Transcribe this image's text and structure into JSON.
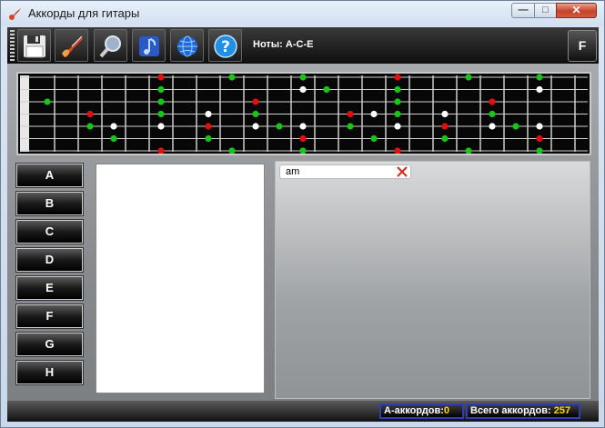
{
  "window": {
    "title": "Аккорды для гитары",
    "buttons": {
      "minimize": "—",
      "maximize": "□",
      "close": "✕"
    }
  },
  "toolbar": {
    "buttons": [
      {
        "name": "save-button",
        "icon": "floppy-disk-icon"
      },
      {
        "name": "guitar-button",
        "icon": "guitar-icon"
      },
      {
        "name": "search-button",
        "icon": "magnifier-icon"
      },
      {
        "name": "music-button",
        "icon": "music-note-icon"
      },
      {
        "name": "web-button",
        "icon": "globe-icon"
      },
      {
        "name": "help-button",
        "icon": "help-icon"
      }
    ],
    "notes_label": "Ноты: A-C-E",
    "f_button": "F"
  },
  "fretboard": {
    "strings": 6,
    "dots": [
      {
        "fret": 0,
        "string": 2,
        "c": "g"
      },
      {
        "fret": 2,
        "string": 3,
        "c": "r"
      },
      {
        "fret": 2,
        "string": 4,
        "c": "g"
      },
      {
        "fret": 3,
        "string": 4,
        "c": "w"
      },
      {
        "fret": 3,
        "string": 5,
        "c": "g"
      },
      {
        "fret": 5,
        "string": 0,
        "c": "r"
      },
      {
        "fret": 5,
        "string": 1,
        "c": "g"
      },
      {
        "fret": 5,
        "string": 2,
        "c": "g"
      },
      {
        "fret": 5,
        "string": 3,
        "c": "g"
      },
      {
        "fret": 5,
        "string": 4,
        "c": "w"
      },
      {
        "fret": 5,
        "string": 6,
        "c": "r"
      },
      {
        "fret": 7,
        "string": 3,
        "c": "w"
      },
      {
        "fret": 7,
        "string": 4,
        "c": "r"
      },
      {
        "fret": 7,
        "string": 5,
        "c": "g"
      },
      {
        "fret": 8,
        "string": 0,
        "c": "g"
      },
      {
        "fret": 8,
        "string": 6,
        "c": "g"
      },
      {
        "fret": 9,
        "string": 2,
        "c": "r"
      },
      {
        "fret": 9,
        "string": 3,
        "c": "g"
      },
      {
        "fret": 9,
        "string": 4,
        "c": "w"
      },
      {
        "fret": 10,
        "string": 4,
        "c": "g"
      },
      {
        "fret": 11,
        "string": 0,
        "c": "g"
      },
      {
        "fret": 11,
        "string": 1,
        "c": "w"
      },
      {
        "fret": 11,
        "string": 4,
        "c": "w"
      },
      {
        "fret": 11,
        "string": 5,
        "c": "r"
      },
      {
        "fret": 11,
        "string": 6,
        "c": "g"
      },
      {
        "fret": 12,
        "string": 1,
        "c": "g"
      },
      {
        "fret": 13,
        "string": 3,
        "c": "r"
      },
      {
        "fret": 13,
        "string": 4,
        "c": "g"
      },
      {
        "fret": 14,
        "string": 3,
        "c": "w"
      },
      {
        "fret": 14,
        "string": 5,
        "c": "g"
      },
      {
        "fret": 15,
        "string": 0,
        "c": "r"
      },
      {
        "fret": 15,
        "string": 1,
        "c": "g"
      },
      {
        "fret": 15,
        "string": 2,
        "c": "g"
      },
      {
        "fret": 15,
        "string": 3,
        "c": "g"
      },
      {
        "fret": 15,
        "string": 4,
        "c": "w"
      },
      {
        "fret": 15,
        "string": 6,
        "c": "r"
      },
      {
        "fret": 17,
        "string": 3,
        "c": "w"
      },
      {
        "fret": 17,
        "string": 4,
        "c": "r"
      },
      {
        "fret": 17,
        "string": 5,
        "c": "g"
      },
      {
        "fret": 18,
        "string": 0,
        "c": "g"
      },
      {
        "fret": 18,
        "string": 6,
        "c": "g"
      },
      {
        "fret": 19,
        "string": 2,
        "c": "r"
      },
      {
        "fret": 19,
        "string": 3,
        "c": "g"
      },
      {
        "fret": 19,
        "string": 4,
        "c": "w"
      },
      {
        "fret": 20,
        "string": 4,
        "c": "g"
      },
      {
        "fret": 21,
        "string": 0,
        "c": "g"
      },
      {
        "fret": 21,
        "string": 1,
        "c": "w"
      },
      {
        "fret": 21,
        "string": 4,
        "c": "w"
      },
      {
        "fret": 21,
        "string": 5,
        "c": "r"
      },
      {
        "fret": 21,
        "string": 6,
        "c": "g"
      }
    ],
    "colors": {
      "g": "#19c419",
      "r": "#e01010",
      "w": "#ffffff"
    }
  },
  "chord_buttons": [
    "A",
    "B",
    "C",
    "D",
    "E",
    "F",
    "G",
    "H"
  ],
  "search": {
    "value": "am"
  },
  "status": {
    "a_chords_label": "А-аккордов:",
    "a_chords_value": "0",
    "total_label": "Всего аккордов:",
    "total_value": "257"
  }
}
